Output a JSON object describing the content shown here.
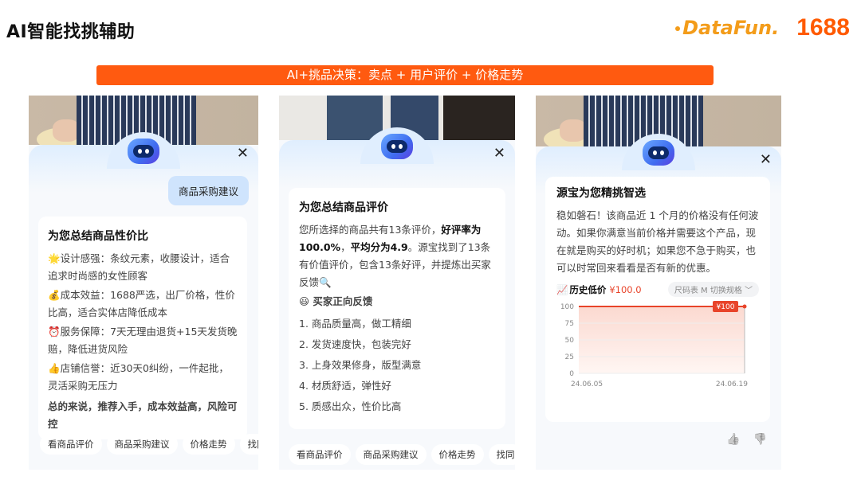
{
  "slide": {
    "title": "AI智能找挑辅助",
    "brand_datafun": "DataFun.",
    "brand_1688": "1688",
    "banner": "AI+挑品决策：卖点 + 用户评价 + 价格走势"
  },
  "panel1": {
    "close": "✕",
    "user_message": "商品采购建议",
    "card_title": "为您总结商品性价比",
    "items": [
      {
        "icon": "🌟",
        "text": "设计感强：条纹元素，收腰设计，适合追求时尚感的女性顾客"
      },
      {
        "icon": "💰",
        "text": "成本效益：1688严选，出厂价格，性价比高，适合实体店降低成本"
      },
      {
        "icon": "⏰",
        "text": "服务保障：7天无理由退货+15天发货晚赔，降低进货风险"
      },
      {
        "icon": "👍",
        "text": "店铺信誉：近30天0纠纷，一件起批，灵活采购无压力"
      }
    ],
    "conclusion": "总的来说，推荐入手，成本效益高，风险可控",
    "chips": [
      "看商品评价",
      "商品采购建议",
      "价格走势",
      "找同"
    ]
  },
  "panel2": {
    "close": "✕",
    "card_title": "为您总结商品评价",
    "intro_1": "您所选择的商品共有13条评价，",
    "intro_b1": "好评率为100.0%",
    "intro_2": "，",
    "intro_b2": "平均分为4.9",
    "intro_3": "。源宝找到了13条有价值评价，包含13条好评，并提炼出买家反馈🔍",
    "section_icon": "😃",
    "section_title": "买家正向反馈",
    "feedback": [
      "1. 商品质量高，做工精细",
      "2. 发货速度快，包装完好",
      "3. 上身效果修身，版型满意",
      "4. 材质舒适，弹性好",
      "5. 质感出众，性价比高"
    ],
    "chips": [
      "看商品评价",
      "商品采购建议",
      "价格走势",
      "找同"
    ]
  },
  "panel3": {
    "close": "✕",
    "card_title": "源宝为您精挑智选",
    "body": "稳如磐石！该商品近 1 个月的价格没有任何波动。如果你满意当前价格并需要这个产品，现在就是购买的好时机；如果您不急于购买，也可以时常回来看看是否有新的优惠。",
    "chart_label": "历史低价",
    "chart_value": "¥100.0",
    "size_selector": "尺码表 M  切换规格 ﹀",
    "thumb_up": "👍",
    "thumb_down": "👎"
  },
  "chart_data": {
    "type": "line",
    "x": [
      "24.06.05",
      "24.06.19"
    ],
    "values": [
      100,
      100
    ],
    "y_ticks": [
      0,
      25,
      50,
      75,
      100
    ],
    "ylim": [
      0,
      100
    ],
    "end_label": "¥100",
    "color": "#e8442a"
  }
}
